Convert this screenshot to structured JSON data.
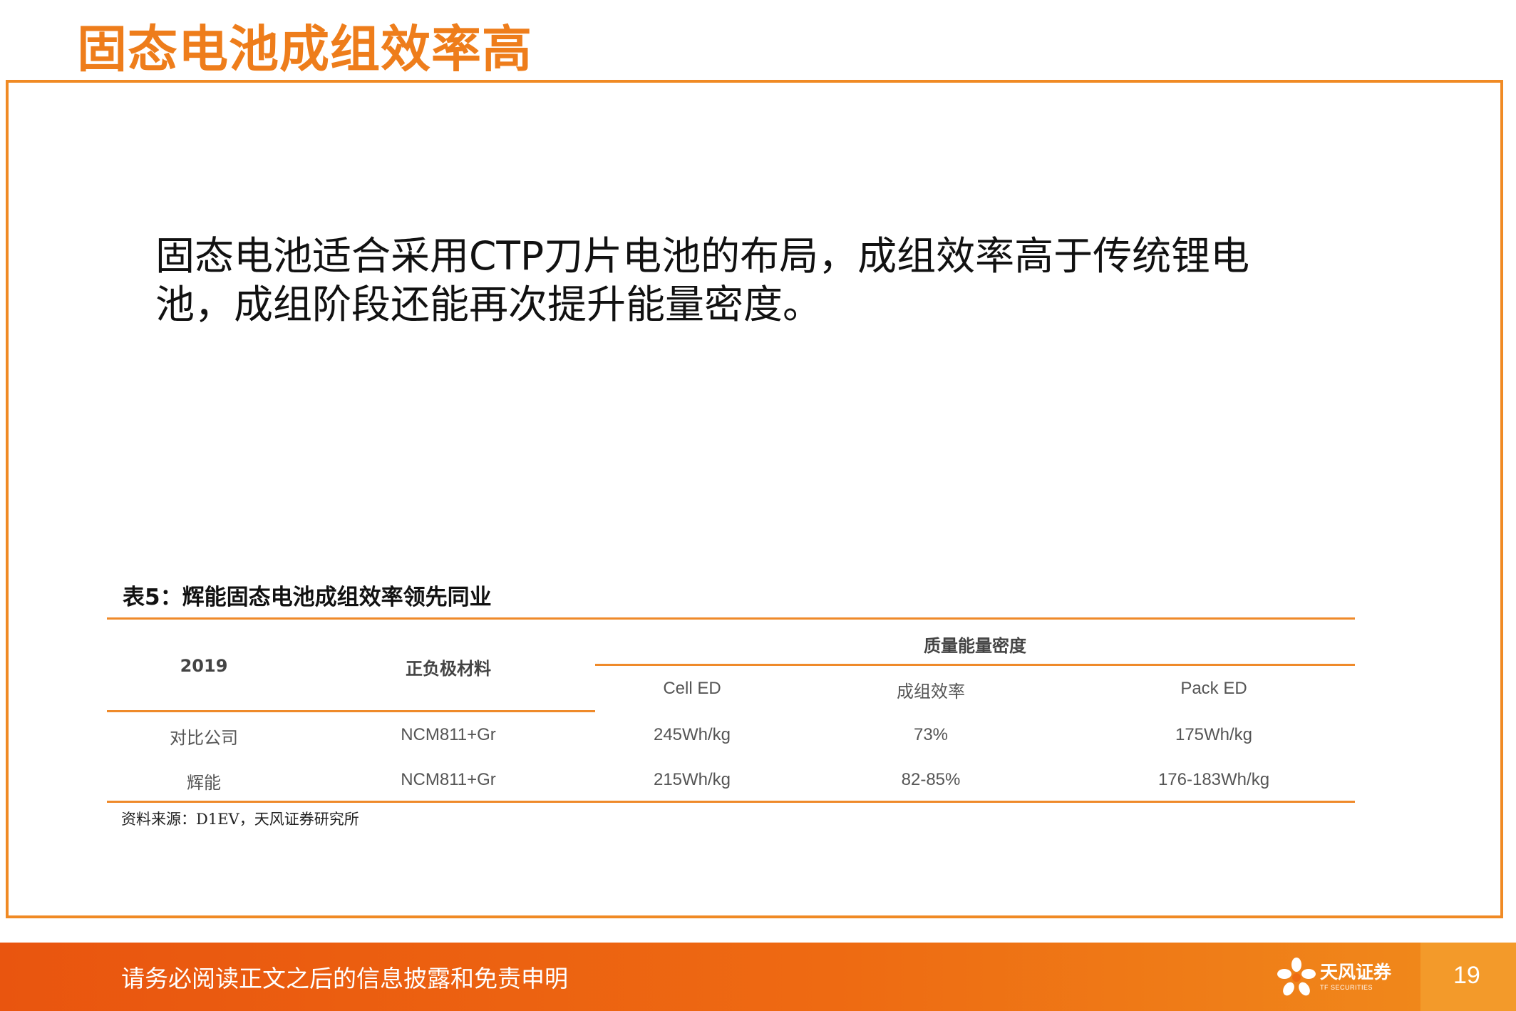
{
  "page_title": "固态电池成组效率高",
  "body_text": "固态电池适合采用CTP刀片电池的布局，成组效率高于传统锂电池，成组阶段还能再次提升能量密度。",
  "table": {
    "caption": "表5：辉能固态电池成组效率领先同业",
    "col_year": "2019",
    "col_material": "正负极材料",
    "col_group": "质量能量密度",
    "sub_cell_ed": "Cell ED",
    "sub_efficiency": "成组效率",
    "sub_pack_ed": "Pack ED",
    "rows": [
      {
        "company": "对比公司",
        "material": "NCM811+Gr",
        "cell_ed": "245Wh/kg",
        "efficiency": "73%",
        "pack_ed": "175Wh/kg"
      },
      {
        "company": "辉能",
        "material": "NCM811+Gr",
        "cell_ed": "215Wh/kg",
        "efficiency": "82-85%",
        "pack_ed": "176-183Wh/kg"
      }
    ],
    "source": "资料来源：D1EV，天风证券研究所"
  },
  "footer": {
    "disclaimer": "请务必阅读正文之后的信息披露和免责申明",
    "logo_name": "天风证券",
    "logo_sub": "TF SECURITIES",
    "page_number": "19"
  },
  "colors": {
    "accent": "#ee7d1b",
    "frame": "#f08a24",
    "footer": "#e9550f"
  }
}
